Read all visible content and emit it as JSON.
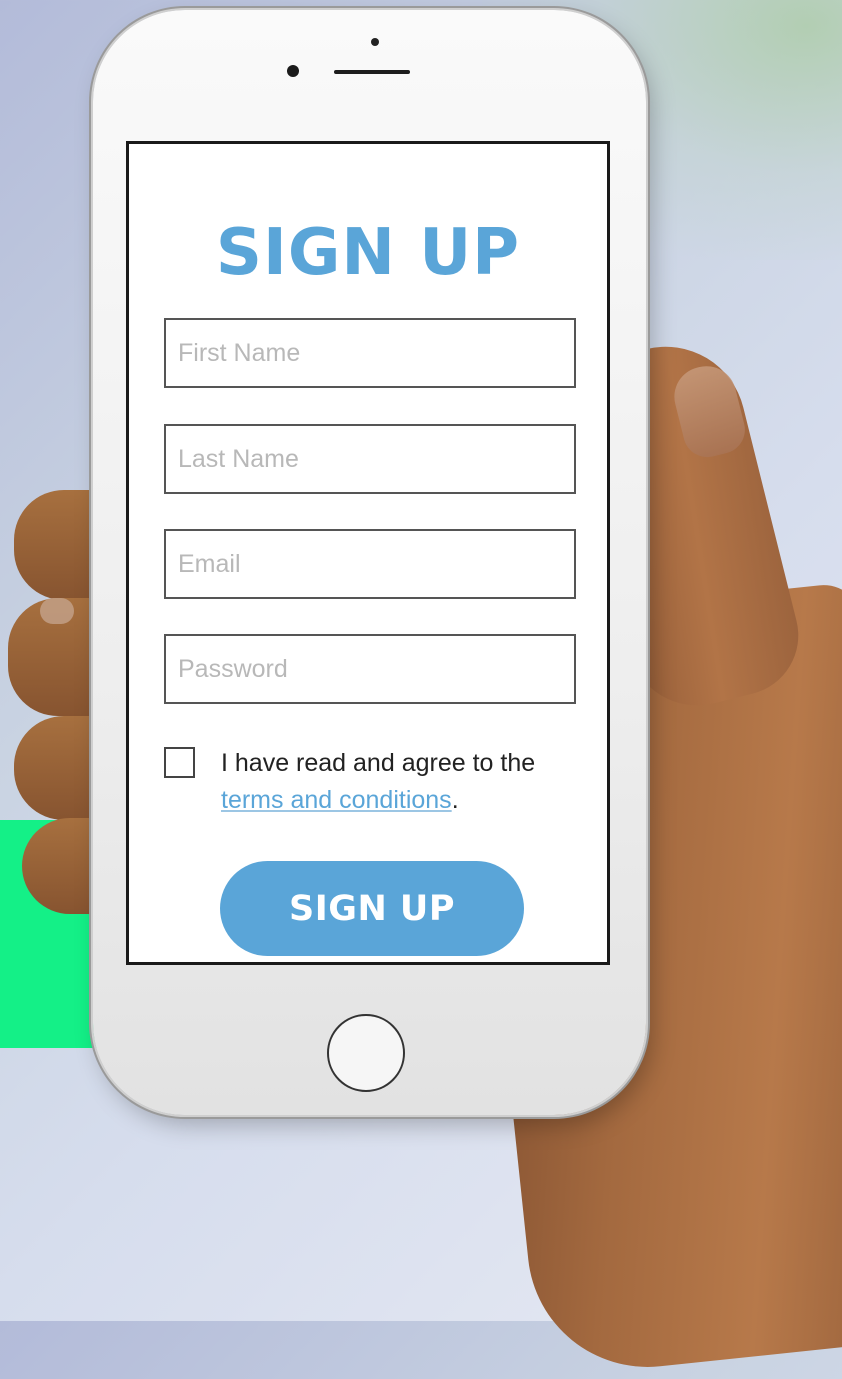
{
  "colors": {
    "accent": "#5aa5d8",
    "brand_green": "#14f087"
  },
  "signup": {
    "title": "SIGN UP",
    "fields": {
      "first_name_placeholder": "First Name",
      "last_name_placeholder": "Last Name",
      "email_placeholder": "Email",
      "password_placeholder": "Password"
    },
    "agreement": {
      "checked": false,
      "text_before": "I have read and agree to the",
      "link_text": "terms and conditions",
      "text_after": "."
    },
    "submit_label": "SIGN UP"
  },
  "icons": {
    "home_button": "home-button-icon"
  }
}
